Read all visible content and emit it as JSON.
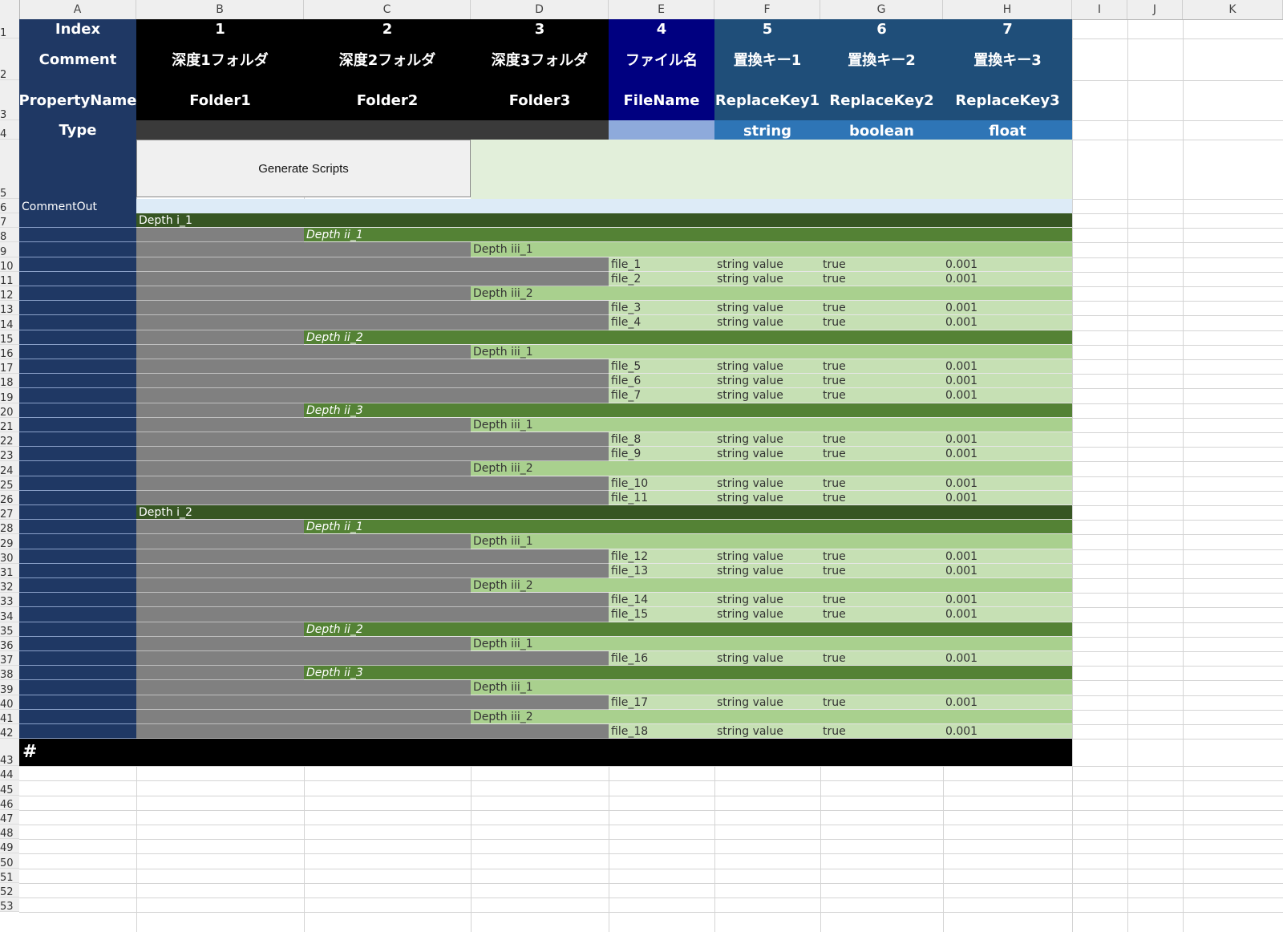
{
  "columns": [
    "A",
    "B",
    "C",
    "D",
    "E",
    "F",
    "G",
    "H",
    "I",
    "J",
    "K"
  ],
  "row_numbers": [
    "1",
    "2",
    "3",
    "4",
    "5",
    "6",
    "7",
    "8",
    "9",
    "10",
    "11",
    "12",
    "13",
    "14",
    "15",
    "16",
    "17",
    "18",
    "19",
    "20",
    "21",
    "22",
    "23",
    "24",
    "25",
    "26",
    "27",
    "28",
    "29",
    "30",
    "31",
    "32",
    "33",
    "34",
    "35",
    "36",
    "37",
    "38",
    "39",
    "40",
    "41",
    "42",
    "43",
    "44",
    "45",
    "46",
    "47",
    "48",
    "49",
    "50",
    "51",
    "52",
    "53"
  ],
  "header": {
    "index_label": "Index",
    "comment_label": "Comment",
    "property_label": "PropertyName",
    "type_label": "Type",
    "indices": [
      "1",
      "2",
      "3",
      "4",
      "5",
      "6",
      "7"
    ],
    "comments": [
      "深度1フォルダ",
      "深度2フォルダ",
      "深度3フォルダ",
      "ファイル名",
      "置換キー1",
      "置換キー2",
      "置換キー3"
    ],
    "properties": [
      "Folder1",
      "Folder2",
      "Folder3",
      "FileName",
      "ReplaceKey1",
      "ReplaceKey2",
      "ReplaceKey3"
    ],
    "types": [
      "",
      "",
      "",
      "",
      "string",
      "boolean",
      "float"
    ]
  },
  "button": {
    "label": "Generate Scripts"
  },
  "comment_out_label": "CommentOut",
  "end_marker": "#",
  "colors": {
    "navy": "#1f3864",
    "black": "#000000",
    "darkblue": "#000080",
    "steel": "#1f4e79",
    "depth1": "#375623",
    "depth2": "#548235",
    "depth3": "#a9d08e",
    "file": "#c6e0b4",
    "gray": "#808080",
    "lightgreen": "#e2efda",
    "lightblue": "#ddebf7"
  },
  "data_rows": [
    {
      "level": 1,
      "text": "Depth i_1"
    },
    {
      "level": 2,
      "text": "Depth ii_1"
    },
    {
      "level": 3,
      "text": "Depth iii_1"
    },
    {
      "level": 4,
      "file": "file_1",
      "s": "string value",
      "b": "true",
      "f": "0.001"
    },
    {
      "level": 4,
      "file": "file_2",
      "s": "string value",
      "b": "true",
      "f": "0.001"
    },
    {
      "level": 3,
      "text": "Depth iii_2"
    },
    {
      "level": 4,
      "file": "file_3",
      "s": "string value",
      "b": "true",
      "f": "0.001"
    },
    {
      "level": 4,
      "file": "file_4",
      "s": "string value",
      "b": "true",
      "f": "0.001"
    },
    {
      "level": 2,
      "text": "Depth ii_2"
    },
    {
      "level": 3,
      "text": "Depth iii_1"
    },
    {
      "level": 4,
      "file": "file_5",
      "s": "string value",
      "b": "true",
      "f": "0.001"
    },
    {
      "level": 4,
      "file": "file_6",
      "s": "string value",
      "b": "true",
      "f": "0.001"
    },
    {
      "level": 4,
      "file": "file_7",
      "s": "string value",
      "b": "true",
      "f": "0.001"
    },
    {
      "level": 2,
      "text": "Depth ii_3"
    },
    {
      "level": 3,
      "text": "Depth iii_1"
    },
    {
      "level": 4,
      "file": "file_8",
      "s": "string value",
      "b": "true",
      "f": "0.001"
    },
    {
      "level": 4,
      "file": "file_9",
      "s": "string value",
      "b": "true",
      "f": "0.001"
    },
    {
      "level": 3,
      "text": "Depth iii_2"
    },
    {
      "level": 4,
      "file": "file_10",
      "s": "string value",
      "b": "true",
      "f": "0.001"
    },
    {
      "level": 4,
      "file": "file_11",
      "s": "string value",
      "b": "true",
      "f": "0.001"
    },
    {
      "level": 1,
      "text": "Depth i_2"
    },
    {
      "level": 2,
      "text": "Depth ii_1"
    },
    {
      "level": 3,
      "text": "Depth iii_1"
    },
    {
      "level": 4,
      "file": "file_12",
      "s": "string value",
      "b": "true",
      "f": "0.001"
    },
    {
      "level": 4,
      "file": "file_13",
      "s": "string value",
      "b": "true",
      "f": "0.001"
    },
    {
      "level": 3,
      "text": "Depth iii_2"
    },
    {
      "level": 4,
      "file": "file_14",
      "s": "string value",
      "b": "true",
      "f": "0.001"
    },
    {
      "level": 4,
      "file": "file_15",
      "s": "string value",
      "b": "true",
      "f": "0.001"
    },
    {
      "level": 2,
      "text": "Depth ii_2"
    },
    {
      "level": 3,
      "text": "Depth iii_1"
    },
    {
      "level": 4,
      "file": "file_16",
      "s": "string value",
      "b": "true",
      "f": "0.001"
    },
    {
      "level": 2,
      "text": "Depth ii_3"
    },
    {
      "level": 3,
      "text": "Depth iii_1"
    },
    {
      "level": 4,
      "file": "file_17",
      "s": "string value",
      "b": "true",
      "f": "0.001"
    },
    {
      "level": 3,
      "text": "Depth iii_2"
    },
    {
      "level": 4,
      "file": "file_18",
      "s": "string value",
      "b": "true",
      "f": "0.001"
    }
  ]
}
